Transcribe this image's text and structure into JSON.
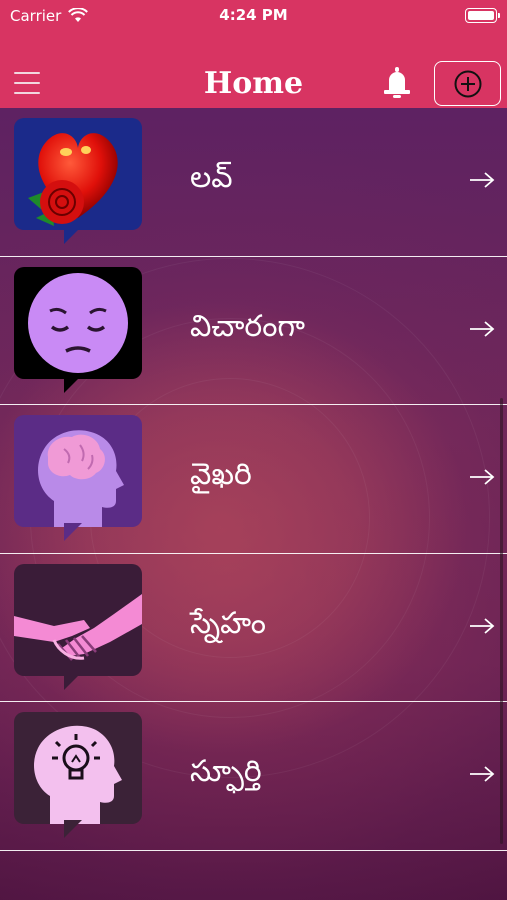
{
  "status_bar": {
    "carrier": "Carrier",
    "time": "4:24 PM"
  },
  "header": {
    "title": "Home",
    "color": "#d83462"
  },
  "items": [
    {
      "label": "లవ్",
      "thumb": "heart-rose-icon",
      "arrow": "→"
    },
    {
      "label": "విచారంగా",
      "thumb": "sad-face-icon",
      "arrow": "→"
    },
    {
      "label": "వైఖరి",
      "thumb": "brain-head-icon",
      "arrow": "→"
    },
    {
      "label": "స్నేహం",
      "thumb": "handshake-icon",
      "arrow": "→"
    },
    {
      "label": "స్ఫూర్తి",
      "thumb": "idea-head-icon",
      "arrow": "→"
    }
  ]
}
